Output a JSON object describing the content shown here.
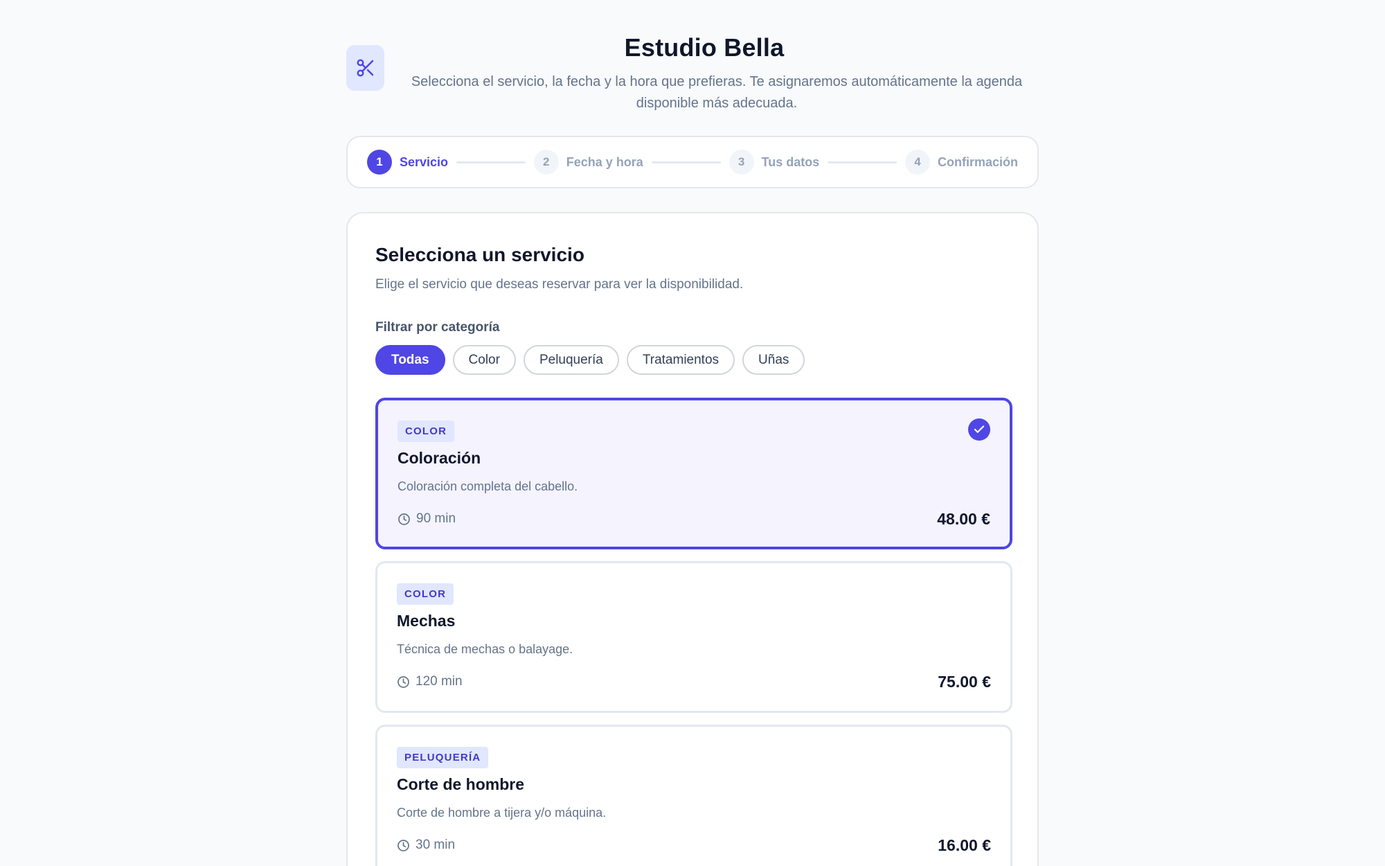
{
  "header": {
    "title": "Estudio Bella",
    "subtitle": "Selecciona el servicio, la fecha y la hora que prefieras. Te asignaremos automáticamente la agenda disponible más adecuada.",
    "logo_icon": "scissors-icon"
  },
  "stepper": {
    "steps": [
      {
        "number": "1",
        "label": "Servicio",
        "active": true
      },
      {
        "number": "2",
        "label": "Fecha y hora",
        "active": false
      },
      {
        "number": "3",
        "label": "Tus datos",
        "active": false
      },
      {
        "number": "4",
        "label": "Confirmación",
        "active": false
      }
    ]
  },
  "main": {
    "title": "Selecciona un servicio",
    "subtitle": "Elige el servicio que deseas reservar para ver la disponibilidad.",
    "filter_label": "Filtrar por categoría",
    "filters": [
      "Todas",
      "Color",
      "Peluquería",
      "Tratamientos",
      "Uñas"
    ],
    "active_filter": "Todas",
    "services": [
      {
        "category": "COLOR",
        "name": "Coloración",
        "description": "Coloración completa del cabello.",
        "duration": "90 min",
        "price": "48.00 €",
        "selected": true
      },
      {
        "category": "COLOR",
        "name": "Mechas",
        "description": "Técnica de mechas o balayage.",
        "duration": "120 min",
        "price": "75.00 €",
        "selected": false
      },
      {
        "category": "PELUQUERÍA",
        "name": "Corte de hombre",
        "description": "Corte de hombre a tijera y/o máquina.",
        "duration": "30 min",
        "price": "16.00 €",
        "selected": false
      }
    ]
  },
  "colors": {
    "accent": "#4f46e5",
    "accent_light": "#e0e7ff",
    "selected_bg": "#f4f3fe",
    "text": "#0f172a",
    "muted": "#64748b",
    "background": "#f8fafc"
  }
}
